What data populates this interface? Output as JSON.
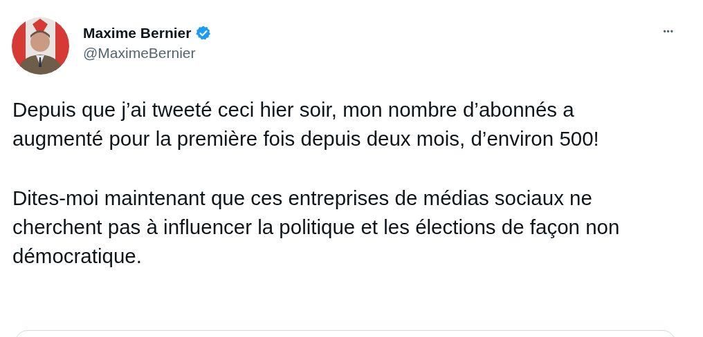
{
  "author": {
    "name": "Maxime Bernier",
    "verified": true,
    "handle": "@MaximeBernier"
  },
  "more_button": "•••",
  "paragraphs": [
    "Depuis que j’ai tweeté ceci hier soir, mon nombre d’abonnés a augmenté pour la première fois depuis deux mois, d’environ 500!",
    "Dites-moi maintenant que ces entreprises de médias sociaux ne cherchent pas à influencer la politique et les élections de façon non démocratique."
  ]
}
